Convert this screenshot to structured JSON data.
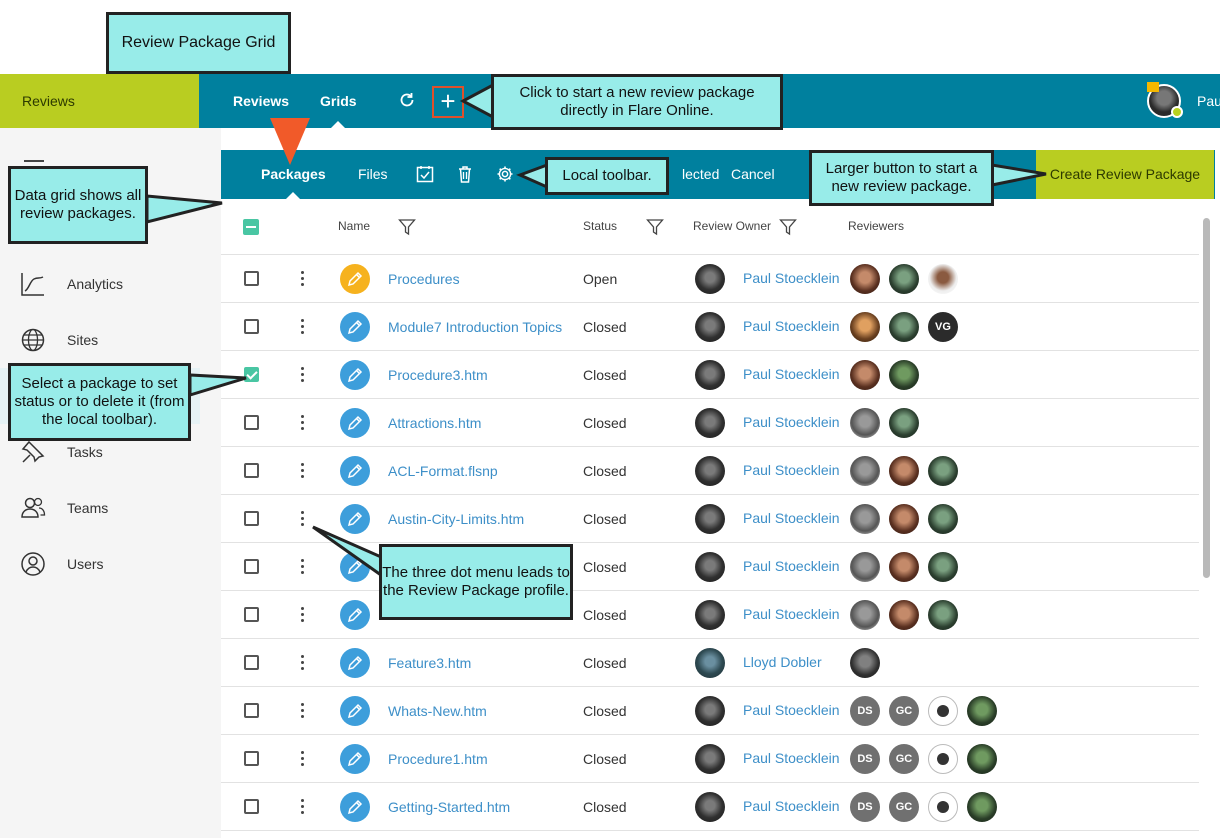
{
  "callouts": {
    "title": "Review Package Grid",
    "new_package": "Click to start a new review package directly in Flare Online.",
    "data_grid": "Data grid shows all review packages.",
    "local_toolbar": "Local toolbar.",
    "larger_button": "Larger button to start a new review package.",
    "select_package": "Select a package to set status or to delete it (from the local toolbar).",
    "three_dot": "The three dot menu leads to the Review Package profile."
  },
  "topbar": {
    "brand": "Reviews",
    "tabs": [
      "Reviews",
      "Grids"
    ],
    "active_tab": "Grids",
    "user_name_partial": "Pau"
  },
  "sidebar": {
    "items": [
      {
        "label": "Analytics",
        "icon": "chart-line-icon"
      },
      {
        "label": "Sites",
        "icon": "globe-icon"
      },
      {
        "label": "Tasks",
        "icon": "pin-icon"
      },
      {
        "label": "Teams",
        "icon": "people-icon"
      },
      {
        "label": "Users",
        "icon": "user-circle-icon"
      }
    ]
  },
  "toolbar": {
    "packages": "Packages",
    "files": "Files",
    "partial_label": "lected",
    "cancel": "Cancel",
    "create": "Create Review Package"
  },
  "grid": {
    "columns": {
      "name": "Name",
      "status": "Status",
      "owner": "Review Owner",
      "reviewers": "Reviewers"
    },
    "rows": [
      {
        "name": "Procedures",
        "status": "Open",
        "owner": "Paul Stoecklein",
        "icon": "open",
        "checked": false,
        "reviewers": [
          "p1",
          "p2",
          "p3"
        ]
      },
      {
        "name": "Module7 Introduction Topics",
        "status": "Closed",
        "owner": "Paul Stoecklein",
        "icon": "closed",
        "checked": false,
        "reviewers": [
          "p4",
          "p2",
          "VG"
        ]
      },
      {
        "name": "Procedure3.htm",
        "status": "Closed",
        "owner": "Paul Stoecklein",
        "icon": "closed",
        "checked": true,
        "reviewers": [
          "p1",
          "p7"
        ]
      },
      {
        "name": "Attractions.htm",
        "status": "Closed",
        "owner": "Paul Stoecklein",
        "icon": "closed",
        "checked": false,
        "reviewers": [
          "p5",
          "p2"
        ]
      },
      {
        "name": "ACL-Format.flsnp",
        "status": "Closed",
        "owner": "Paul Stoecklein",
        "icon": "closed",
        "checked": false,
        "reviewers": [
          "p5",
          "p1",
          "p2"
        ]
      },
      {
        "name": "Austin-City-Limits.htm",
        "status": "Closed",
        "owner": "Paul Stoecklein",
        "icon": "closed",
        "checked": false,
        "reviewers": [
          "p5",
          "p1",
          "p2"
        ]
      },
      {
        "name": "",
        "status": "Closed",
        "owner": "Paul Stoecklein",
        "icon": "closed",
        "checked": false,
        "reviewers": [
          "p5",
          "p1",
          "p2"
        ]
      },
      {
        "name": "",
        "status": "Closed",
        "owner": "Paul Stoecklein",
        "icon": "closed",
        "checked": false,
        "reviewers": [
          "p5",
          "p1",
          "p2"
        ]
      },
      {
        "name": "Feature3.htm",
        "status": "Closed",
        "owner": "Lloyd Dobler",
        "icon": "closed",
        "checked": false,
        "reviewers": [
          "p6"
        ]
      },
      {
        "name": "Whats-New.htm",
        "status": "Closed",
        "owner": "Paul Stoecklein",
        "icon": "closed",
        "checked": false,
        "reviewers": [
          "DS",
          "GC",
          "badge",
          "p7"
        ]
      },
      {
        "name": "Procedure1.htm",
        "status": "Closed",
        "owner": "Paul Stoecklein",
        "icon": "closed",
        "checked": false,
        "reviewers": [
          "DS",
          "GC",
          "badge",
          "p7"
        ]
      },
      {
        "name": "Getting-Started.htm",
        "status": "Closed",
        "owner": "Paul Stoecklein",
        "icon": "closed",
        "checked": false,
        "reviewers": [
          "DS",
          "GC",
          "badge",
          "p7"
        ]
      }
    ]
  }
}
